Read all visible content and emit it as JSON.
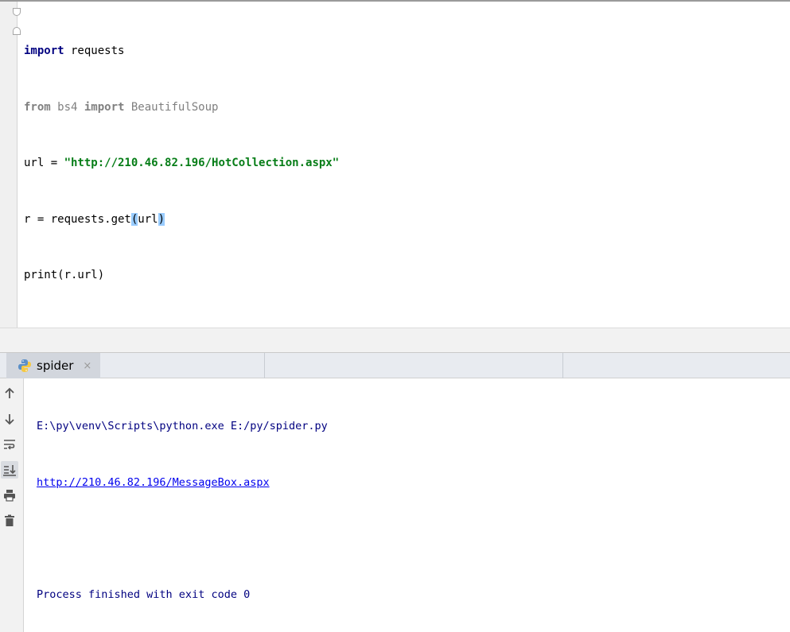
{
  "editor": {
    "lines": {
      "l1": {
        "kw": "import",
        "rest": " requests"
      },
      "l2": {
        "kw1": "from",
        "mod": " bs4 ",
        "kw2": "import",
        "name": " BeautifulSoup"
      },
      "l3": {
        "pre": "url = ",
        "str": "\"http://210.46.82.196/HotCollection.aspx\""
      },
      "l4": {
        "pre": "r = requests.get",
        "open": "(",
        "arg": "url",
        "close": ")"
      },
      "l5": {
        "text": "print(r.url)"
      }
    }
  },
  "run": {
    "tab_label": "spider",
    "tab_close": "×",
    "console": {
      "command": "E:\\py\\venv\\Scripts\\python.exe E:/py/spider.py",
      "output_link": "http://210.46.82.196/MessageBox.aspx",
      "exit_message": "Process finished with exit code 0"
    }
  },
  "icons": {
    "tab": "python-file-icon",
    "toolbar": [
      "arrow-up-icon",
      "arrow-down-icon",
      "soft-wrap-icon",
      "scroll-to-end-icon",
      "print-icon",
      "trash-icon"
    ]
  },
  "colors": {
    "keyword": "#000080",
    "string": "#067d17",
    "caret_line": "#fcfadf",
    "brace_match": "#99ccff",
    "console_text": "#000080",
    "link": "#0000ee"
  }
}
